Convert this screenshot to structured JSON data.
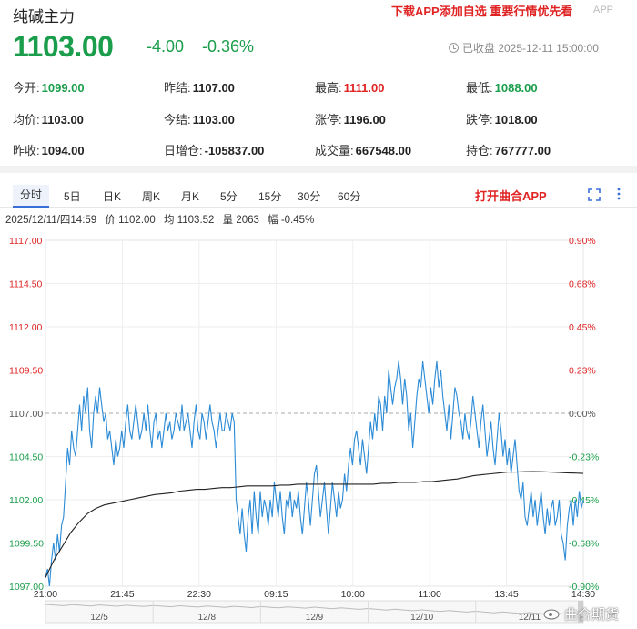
{
  "header": {
    "title": "纯碱主力",
    "promo": "下载APP添加自选 重要行情优先看",
    "promo_tag": "APP"
  },
  "quote": {
    "price": "1103.00",
    "change": "-4.00",
    "change_pct": "-0.36%",
    "status": "已收盘  2025-12-11 15:00:00"
  },
  "stats": [
    {
      "label": "今开:",
      "value": "1099.00",
      "color": "green"
    },
    {
      "label": "昨结:",
      "value": "1107.00",
      "color": ""
    },
    {
      "label": "最高:",
      "value": "1111.00",
      "color": "red"
    },
    {
      "label": "最低:",
      "value": "1088.00",
      "color": "green"
    },
    {
      "label": "均价:",
      "value": "1103.00",
      "color": ""
    },
    {
      "label": "今结:",
      "value": "1103.00",
      "color": ""
    },
    {
      "label": "涨停:",
      "value": "1196.00",
      "color": ""
    },
    {
      "label": "跌停:",
      "value": "1018.00",
      "color": ""
    },
    {
      "label": "昨收:",
      "value": "1094.00",
      "color": ""
    },
    {
      "label": "日增仓:",
      "value": "-105837.00",
      "color": ""
    },
    {
      "label": "成交量:",
      "value": "667548.00",
      "color": ""
    },
    {
      "label": "持仓:",
      "value": "767777.00",
      "color": ""
    }
  ],
  "tabs": [
    "分时",
    "5日",
    "日K",
    "周K",
    "月K",
    "5分",
    "15分",
    "30分",
    "60分"
  ],
  "active_tab": "分时",
  "open_app": "打开曲合APP",
  "cursor_info": {
    "time": "2025/12/11/四14:59",
    "price": "价 1102.00",
    "avg": "均 1103.52",
    "volume": "量 2063",
    "amplitude": "幅 -0.45%"
  },
  "watermark": "曲合期货",
  "colors": {
    "up": "#e02424",
    "down": "#1a9e4b",
    "price_line": "#2b8bd6",
    "avg_line": "#222222",
    "accent": "#3a6fd8"
  },
  "chart_data": {
    "type": "line",
    "ylim": [
      1097.0,
      1117.0
    ],
    "pct_ylim": [
      -0.9,
      0.9
    ],
    "reference_price": 1107.0,
    "y_ticks_left": [
      "1117.00",
      "1114.50",
      "1112.00",
      "1109.50",
      "1107.00",
      "1104.50",
      "1102.00",
      "1099.50",
      "1097.00"
    ],
    "y_ticks_right": [
      "0.90%",
      "0.68%",
      "0.45%",
      "0.23%",
      "0.00%",
      "-0.23%",
      "-0.45%",
      "-0.68%",
      "-0.90%"
    ],
    "x_ticks": [
      "21:00",
      "21:45",
      "22:30",
      "09:15",
      "10:00",
      "11:00",
      "13:45",
      "14:30"
    ],
    "nav_ticks": [
      "12/5",
      "12/8",
      "12/9",
      "12/10",
      "12/11"
    ],
    "series": [
      {
        "values": [
          1097.5,
          1098.0,
          1097.0,
          1098.5,
          1099.5,
          1098.5,
          1100.0,
          1099.0,
          1100.5,
          1101.0,
          1103.0,
          1105.0,
          1104.0,
          1106.0,
          1105.0,
          1104.5,
          1106.0,
          1107.5,
          1106.0,
          1108.0,
          1107.0,
          1108.5,
          1106.0,
          1105.0,
          1107.0,
          1108.0,
          1107.0,
          1108.5,
          1107.5,
          1106.5,
          1107.0,
          1105.5,
          1106.0,
          1105.0,
          1104.0,
          1105.5,
          1104.5,
          1105.0,
          1106.0,
          1105.0,
          1106.5,
          1107.5,
          1106.0,
          1105.5,
          1106.5,
          1107.5,
          1106.5,
          1105.5,
          1106.0,
          1107.0,
          1106.0,
          1107.5,
          1106.0,
          1105.0,
          1106.5,
          1107.0,
          1105.5,
          1106.0,
          1105.0,
          1106.0,
          1107.0,
          1106.0,
          1106.5,
          1105.5,
          1106.0,
          1107.0,
          1106.5,
          1106.0,
          1107.5,
          1106.0,
          1106.5,
          1107.0,
          1106.0,
          1105.0,
          1106.5,
          1107.5,
          1106.0,
          1105.5,
          1107.0,
          1106.5,
          1105.5,
          1106.5,
          1107.5,
          1106.5,
          1106.0,
          1105.0,
          1106.0,
          1107.0,
          1106.0,
          1106.0,
          1107.0,
          1106.5,
          1106.0,
          1107.0,
          1106.5,
          1102.0,
          1101.0,
          1100.0,
          1101.5,
          1100.0,
          1099.0,
          1101.0,
          1102.0,
          1100.0,
          1102.5,
          1101.0,
          1100.0,
          1102.5,
          1101.0,
          1102.0,
          1101.5,
          1100.5,
          1102.0,
          1101.0,
          1103.0,
          1102.0,
          1101.0,
          1102.5,
          1101.0,
          1100.0,
          1102.0,
          1101.5,
          1102.5,
          1101.0,
          1102.0,
          1101.5,
          1102.5,
          1101.0,
          1100.0,
          1101.5,
          1103.0,
          1102.0,
          1100.5,
          1102.0,
          1103.5,
          1104.0,
          1102.5,
          1101.0,
          1102.0,
          1103.0,
          1101.5,
          1100.0,
          1101.5,
          1103.0,
          1102.0,
          1101.0,
          1102.5,
          1101.5,
          1102.0,
          1103.5,
          1102.5,
          1104.0,
          1105.0,
          1104.0,
          1105.5,
          1106.0,
          1105.0,
          1104.0,
          1105.5,
          1104.5,
          1103.5,
          1105.0,
          1106.5,
          1105.5,
          1107.0,
          1106.0,
          1108.0,
          1107.5,
          1106.0,
          1108.0,
          1107.0,
          1109.5,
          1108.5,
          1107.5,
          1108.5,
          1109.0,
          1110.0,
          1109.0,
          1107.5,
          1109.0,
          1108.0,
          1106.0,
          1107.0,
          1105.0,
          1106.5,
          1108.0,
          1109.0,
          1108.5,
          1110.0,
          1109.0,
          1108.0,
          1107.0,
          1108.5,
          1107.5,
          1109.0,
          1110.0,
          1108.5,
          1109.5,
          1108.0,
          1107.0,
          1106.0,
          1107.5,
          1105.5,
          1107.0,
          1108.5,
          1108.0,
          1107.0,
          1106.5,
          1105.5,
          1107.0,
          1106.0,
          1105.5,
          1106.5,
          1108.0,
          1107.0,
          1106.0,
          1105.0,
          1106.5,
          1107.5,
          1106.0,
          1104.5,
          1105.5,
          1106.5,
          1105.0,
          1104.0,
          1105.5,
          1107.0,
          1106.0,
          1104.5,
          1105.5,
          1104.0,
          1105.0,
          1103.5,
          1104.5,
          1105.5,
          1104.0,
          1102.5,
          1102.0,
          1103.0,
          1101.0,
          1100.5,
          1101.5,
          1102.5,
          1101.0,
          1102.0,
          1100.5,
          1101.5,
          1102.5,
          1101.0,
          1100.0,
          1101.5,
          1100.5,
          1101.5,
          1102.0,
          1100.5,
          1101.0,
          1102.0,
          1100.0,
          1099.5,
          1098.5,
          1100.5,
          1101.5,
          1102.0,
          1100.5,
          1102.0,
          1101.0,
          1102.5,
          1101.5,
          1102.0
        ]
      },
      {
        "values": [
          1097.5,
          1098.5,
          1099.3,
          1100.1,
          1100.7,
          1101.2,
          1101.5,
          1101.7,
          1101.8,
          1101.9,
          1102.0,
          1102.1,
          1102.2,
          1102.3,
          1102.35,
          1102.4,
          1102.5,
          1102.55,
          1102.6,
          1102.6,
          1102.65,
          1102.7,
          1102.7,
          1102.75,
          1102.8,
          1102.8,
          1102.8,
          1102.8,
          1102.85,
          1102.85,
          1102.9,
          1102.9,
          1102.9,
          1102.9,
          1102.9,
          1102.9,
          1102.9,
          1102.9,
          1102.9,
          1102.9,
          1102.95,
          1102.95,
          1103.0,
          1103.0,
          1103.0,
          1103.05,
          1103.05,
          1103.1,
          1103.15,
          1103.2,
          1103.3,
          1103.4,
          1103.45,
          1103.5,
          1103.55,
          1103.6,
          1103.6,
          1103.62,
          1103.63,
          1103.62,
          1103.6,
          1103.58,
          1103.56,
          1103.54,
          1103.52
        ]
      }
    ]
  }
}
